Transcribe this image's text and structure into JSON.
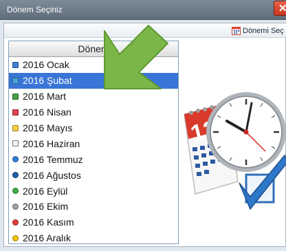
{
  "window": {
    "title": "Dönem Seçiniz"
  },
  "toolbar": {
    "select_label": "Dönemi Seç"
  },
  "grid": {
    "header": "Dönem",
    "rows": [
      {
        "label": "2016 Ocak",
        "color": "#3f7fd4",
        "shape": "square"
      },
      {
        "label": "2016 Şubat",
        "color": "#4aa3d8",
        "shape": "square",
        "selected": true
      },
      {
        "label": "2016 Mart",
        "color": "#43a047",
        "shape": "square"
      },
      {
        "label": "2016 Nisan",
        "color": "#e0414f",
        "shape": "square"
      },
      {
        "label": "2016 Mayıs",
        "color": "#f4d03f",
        "shape": "square"
      },
      {
        "label": "2016 Haziran",
        "color": "#f2f2f2",
        "shape": "square"
      },
      {
        "label": "2016 Temmuz",
        "color": "#2f7fd8",
        "shape": "circle"
      },
      {
        "label": "2016 Ağustos",
        "color": "#1e5fa8",
        "shape": "circle"
      },
      {
        "label": "2016 Eylül",
        "color": "#3fae49",
        "shape": "circle"
      },
      {
        "label": "2016 Ekim",
        "color": "#9aa3ab",
        "shape": "circle"
      },
      {
        "label": "2016 Kasım",
        "color": "#e23b3b",
        "shape": "circle"
      },
      {
        "label": "2016 Aralık",
        "color": "#f4c20d",
        "shape": "circle"
      }
    ]
  },
  "illustration": {
    "day": "12"
  }
}
